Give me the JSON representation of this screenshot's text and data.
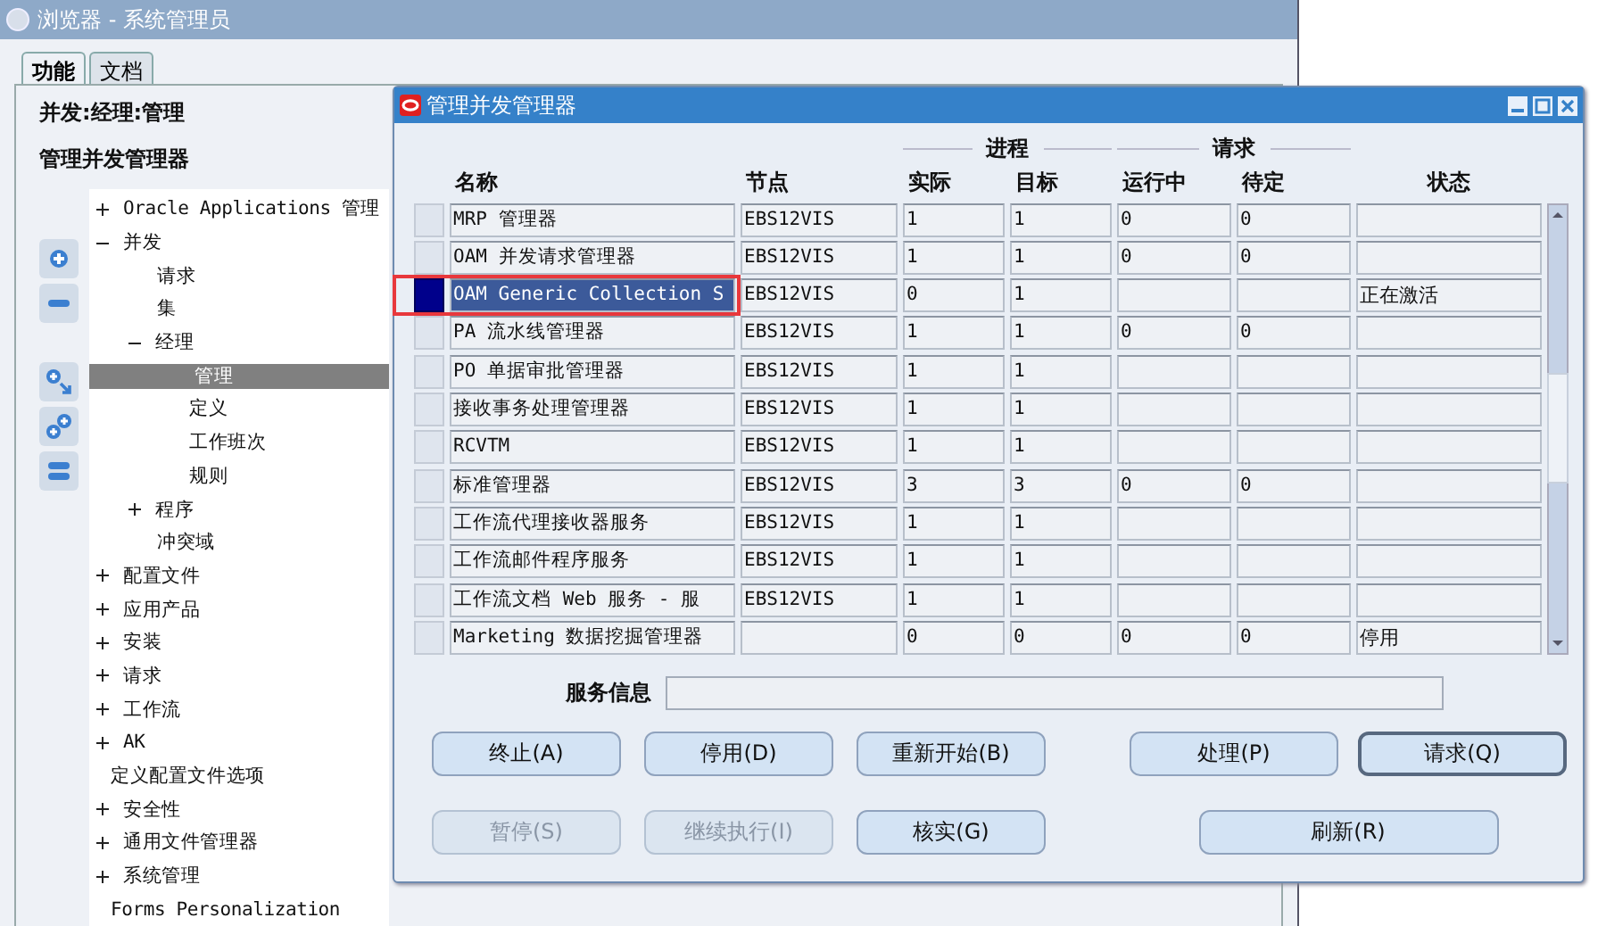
{
  "window": {
    "title": "浏览器 - 系统管理员"
  },
  "tabs": [
    {
      "label": "功能",
      "selected": true
    },
    {
      "label": "文档",
      "selected": false
    }
  ],
  "breadcrumb": "并发:经理:管理",
  "heading": "管理并发管理器",
  "tree": [
    {
      "label": "Oracle Applications 管理",
      "kind": "branch",
      "expanded": false
    },
    {
      "label": "并发",
      "kind": "branch",
      "expanded": true,
      "children": [
        {
          "label": "请求",
          "kind": "leaf",
          "selected": false
        },
        {
          "label": "集",
          "kind": "leaf",
          "selected": false
        },
        {
          "label": "经理",
          "kind": "branch",
          "expanded": true,
          "children": [
            {
              "label": "管理",
              "kind": "leaf",
              "selected": true
            },
            {
              "label": "定义",
              "kind": "leaf",
              "selected": false
            },
            {
              "label": "工作班次",
              "kind": "leaf",
              "selected": false
            },
            {
              "label": "规则",
              "kind": "leaf",
              "selected": false
            }
          ]
        },
        {
          "label": "程序",
          "kind": "branch",
          "expanded": false
        },
        {
          "label": "冲突域",
          "kind": "leaf",
          "selected": false
        }
      ]
    },
    {
      "label": "配置文件",
      "kind": "branch",
      "expanded": false
    },
    {
      "label": "应用产品",
      "kind": "branch",
      "expanded": false
    },
    {
      "label": "安装",
      "kind": "branch",
      "expanded": false
    },
    {
      "label": "请求",
      "kind": "branch",
      "expanded": false
    },
    {
      "label": "工作流",
      "kind": "branch",
      "expanded": false
    },
    {
      "label": "AK",
      "kind": "branch",
      "expanded": false
    },
    {
      "label": "定义配置文件选项",
      "kind": "leaf",
      "selected": false
    },
    {
      "label": "安全性",
      "kind": "branch",
      "expanded": false
    },
    {
      "label": "通用文件管理器",
      "kind": "branch",
      "expanded": false
    },
    {
      "label": "系统管理",
      "kind": "branch",
      "expanded": false
    },
    {
      "label": "Forms Personalization",
      "kind": "leaf",
      "selected": false
    }
  ],
  "dialog": {
    "title": "管理并发管理器",
    "column_groups": [
      {
        "label": "进程"
      },
      {
        "label": "请求"
      }
    ],
    "columns": [
      "名称",
      "节点",
      "实际",
      "目标",
      "运行中",
      "待定",
      "状态"
    ],
    "rows": [
      {
        "name": "MRP 管理器",
        "node": "EBS12VIS",
        "actual": "1",
        "target": "1",
        "running": "0",
        "pending": "0",
        "selected": false,
        "outlined": false
      },
      {
        "name": "OAM 并发请求管理器",
        "node": "EBS12VIS",
        "actual": "1",
        "target": "1",
        "running": "0",
        "pending": "0",
        "selected": false,
        "outlined": false
      },
      {
        "name": "OAM Generic Collection S",
        "node": "EBS12VIS",
        "actual": "0",
        "target": "1",
        "status": "正在激活",
        "selected": true,
        "outlined": true
      },
      {
        "name": "PA 流水线管理器",
        "node": "EBS12VIS",
        "actual": "1",
        "target": "1",
        "running": "0",
        "pending": "0",
        "selected": false,
        "outlined": false
      },
      {
        "name": "PO 单据审批管理器",
        "node": "EBS12VIS",
        "actual": "1",
        "target": "1",
        "selected": false,
        "outlined": false
      },
      {
        "name": "接收事务处理管理器",
        "node": "EBS12VIS",
        "actual": "1",
        "target": "1",
        "selected": false,
        "outlined": false
      },
      {
        "name": "RCVTM",
        "node": "EBS12VIS",
        "actual": "1",
        "target": "1",
        "selected": false,
        "outlined": false
      },
      {
        "name": "标准管理器",
        "node": "EBS12VIS",
        "actual": "3",
        "target": "3",
        "running": "0",
        "pending": "0",
        "selected": false,
        "outlined": false
      },
      {
        "name": "工作流代理接收器服务",
        "node": "EBS12VIS",
        "actual": "1",
        "target": "1",
        "selected": false,
        "outlined": false
      },
      {
        "name": "工作流邮件程序服务",
        "node": "EBS12VIS",
        "actual": "1",
        "target": "1",
        "selected": false,
        "outlined": false
      },
      {
        "name": "工作流文档 Web 服务 - 服",
        "node": "EBS12VIS",
        "actual": "1",
        "target": "1",
        "selected": false,
        "outlined": false
      },
      {
        "name": "Marketing 数据挖掘管理器",
        "actual": "0",
        "target": "0",
        "running": "0",
        "pending": "0",
        "status": "停用",
        "selected": false,
        "outlined": false
      }
    ],
    "service_info": {
      "label": "服务信息"
    },
    "button_rows": [
      {
        "left": [
          {
            "label": "终止(A)",
            "disabled": false,
            "default": false
          },
          {
            "label": "停用(D)",
            "disabled": false,
            "default": false
          },
          {
            "label": "重新开始(B)",
            "disabled": false,
            "default": false
          }
        ],
        "right": [
          {
            "label": "处理(P)",
            "disabled": false,
            "default": false
          },
          {
            "label": "请求(Q)",
            "disabled": false,
            "default": true
          }
        ]
      },
      {
        "left": [
          {
            "label": "暂停(S)",
            "disabled": true,
            "default": false
          },
          {
            "label": "继续执行(I)",
            "disabled": true,
            "default": false
          },
          {
            "label": "核实(G)",
            "disabled": false,
            "default": false
          }
        ],
        "right": [
          {
            "label": "刷新(R)",
            "disabled": false,
            "default": false
          }
        ]
      }
    ]
  }
}
